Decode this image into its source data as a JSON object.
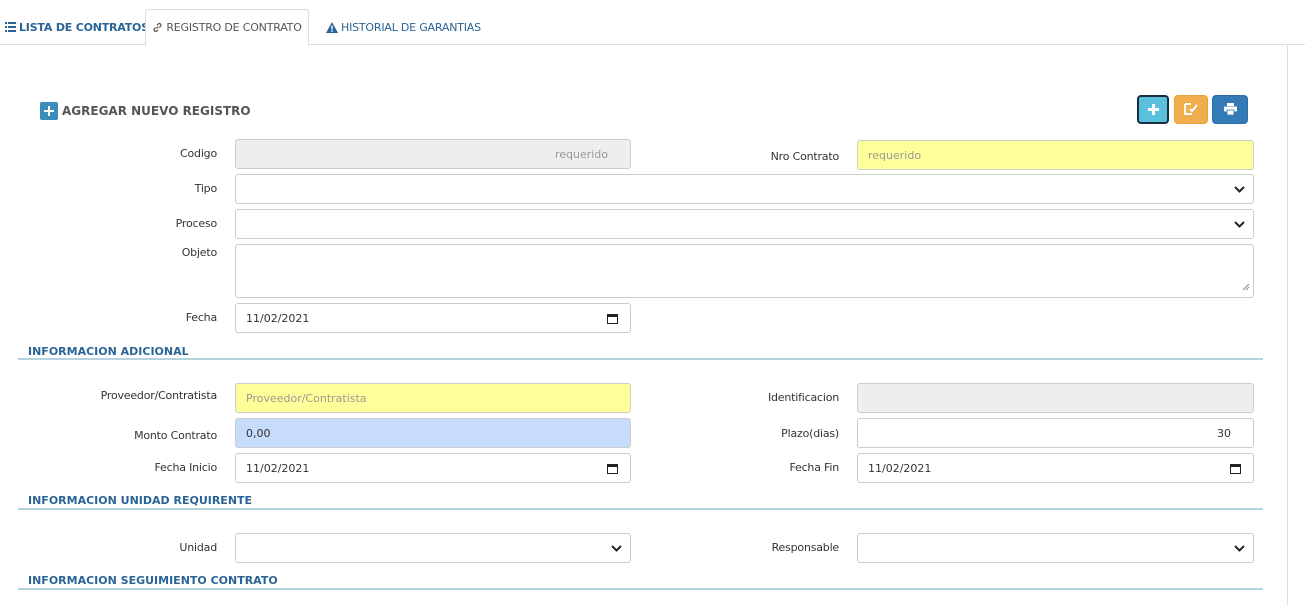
{
  "tabs": [
    {
      "label": "LISTA DE CONTRATOS",
      "icon": "list-icon"
    },
    {
      "label": "REGISTRO DE CONTRATO",
      "icon": "link-icon"
    },
    {
      "label": "HISTORIAL DE GARANTIAS",
      "icon": "warning-icon"
    }
  ],
  "form": {
    "title": "AGREGAR NUEVO REGISTRO",
    "codigo": {
      "label": "Codigo",
      "placeholder": "requerido",
      "value": ""
    },
    "nro_contrato": {
      "label": "Nro Contrato",
      "placeholder": "requerido",
      "value": ""
    },
    "tipo": {
      "label": "Tipo",
      "value": ""
    },
    "proceso": {
      "label": "Proceso",
      "value": ""
    },
    "objeto": {
      "label": "Objeto",
      "value": ""
    },
    "fecha": {
      "label": "Fecha",
      "value": "11/02/2021"
    }
  },
  "sections": {
    "adicional": "INFORMACION ADICIONAL",
    "unidad": "INFORMACION UNIDAD REQUIRENTE",
    "seguimiento": "INFORMACION SEGUIMIENTO CONTRATO"
  },
  "adicional": {
    "proveedor": {
      "label": "Proveedor/Contratista",
      "placeholder": "Proveedor/Contratista"
    },
    "identificacion": {
      "label": "Identificacion",
      "value": ""
    },
    "monto": {
      "label": "Monto Contrato",
      "value": "0,00"
    },
    "plazo": {
      "label": "Plazo(dias)",
      "value": "30"
    },
    "fecha_inicio": {
      "label": "Fecha Inicio",
      "value": "11/02/2021"
    },
    "fecha_fin": {
      "label": "Fecha Fin",
      "value": "11/02/2021"
    }
  },
  "unidad": {
    "unidad": {
      "label": "Unidad",
      "value": ""
    },
    "responsable": {
      "label": "Responsable",
      "value": ""
    }
  },
  "colors": {
    "accent": "#2a6496",
    "btn_add": "#5bc0de",
    "btn_edit": "#f0ad4e",
    "btn_print": "#337ab7",
    "required_bg": "#ffff99",
    "amount_bg": "#c6dcfa"
  }
}
